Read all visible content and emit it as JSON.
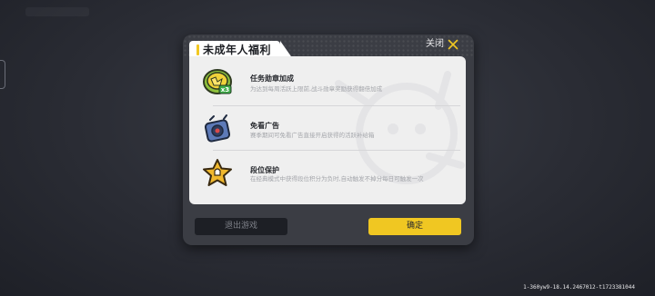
{
  "dialog": {
    "title": "未成年人福利",
    "close_label": "关闭",
    "items": [
      {
        "title": "任务勋章加成",
        "description": "为达到每周活跃上限前,战斗勋章奖励获得翻倍加成",
        "icon": "medal-boost-icon",
        "badge": "x3"
      },
      {
        "title": "免看广告",
        "description": "赛季期间可免看广告直接开启获得的活跃补给箱",
        "icon": "supply-box-icon"
      },
      {
        "title": "段位保护",
        "description": "在经典模式中获得段位积分为负时,自动触发不掉分每日可触发一次",
        "icon": "rank-star-icon"
      }
    ]
  },
  "buttons": {
    "exit_label": "退出游戏",
    "confirm_label": "确定"
  },
  "version_text": "1-360yw9-18.14.2467012-t1723381044",
  "colors": {
    "accent": "#f0c722",
    "dialog_bg": "#3b3d44",
    "panel_bg": "#efefef"
  }
}
